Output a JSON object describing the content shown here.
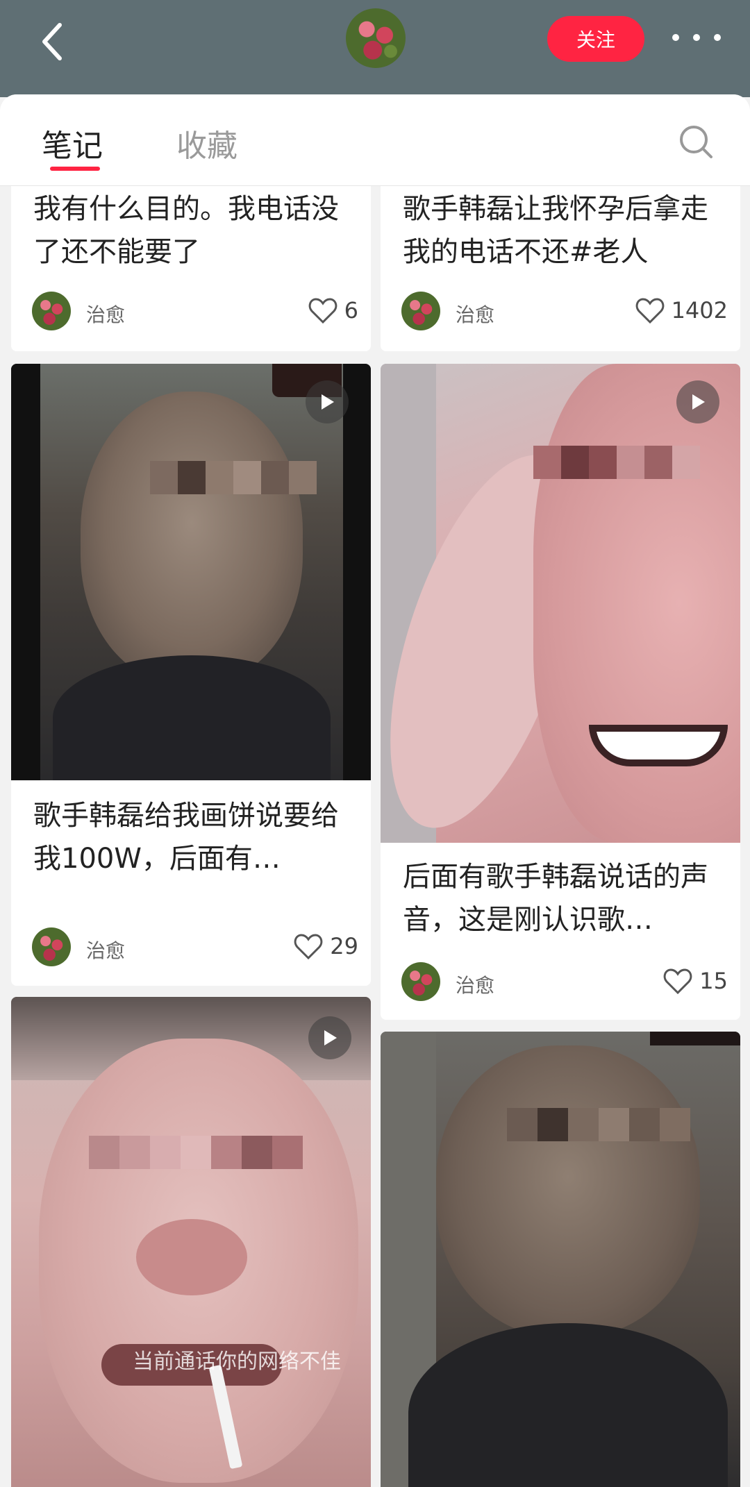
{
  "header": {
    "follow_label": "关注"
  },
  "tabs": [
    {
      "label": "笔记"
    },
    {
      "label": "收藏"
    }
  ],
  "cards": [
    {
      "title": "我有什么目的。我电话没了还不能要了",
      "author": "治愈",
      "likes": "6"
    },
    {
      "title": "歌手韩磊让我怀孕后拿走我的电话不还#老人",
      "author": "治愈",
      "likes": "1402"
    },
    {
      "title": "歌手韩磊给我画饼说要给我100W，后面有…",
      "author": "治愈",
      "likes": "29"
    },
    {
      "title": "后面有歌手韩磊说话的声音，这是刚认识歌…",
      "author": "治愈",
      "likes": "15"
    }
  ],
  "overlay_text": "当前通话你的网络不佳",
  "colors": {
    "accent": "#ff2442",
    "header_bg": "#5f6f74"
  }
}
